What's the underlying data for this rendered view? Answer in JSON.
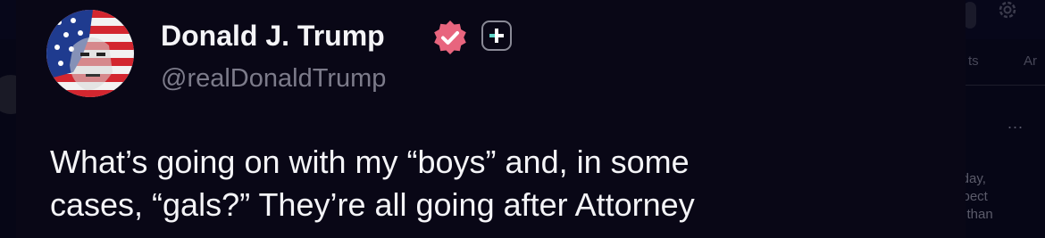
{
  "author": {
    "display_name": "Donald J. Trump",
    "handle": "@realDonaldTrump",
    "avatar_icon": "flag-portrait-avatar",
    "verified_icon": "verified-badge-icon",
    "verified_color": "#e8657e",
    "plus_icon": "plus-badge-icon"
  },
  "post": {
    "text_lines": [
      "What’s going on with my “boys” and, in some",
      "cases, “gals?” They’re all going after Attorney"
    ]
  },
  "background_app": {
    "tab_partial_1": "ts",
    "tab_partial_2": "Ar",
    "more_icon": "more-dots-icon",
    "more_label": "...",
    "snippet_lines": [
      "liday,",
      "xpect",
      "e than"
    ]
  },
  "colors": {
    "page_bg": "#050411",
    "card_bg": "#090716",
    "primary_text": "#f4f4f7",
    "secondary_text": "#7c7b8a"
  }
}
